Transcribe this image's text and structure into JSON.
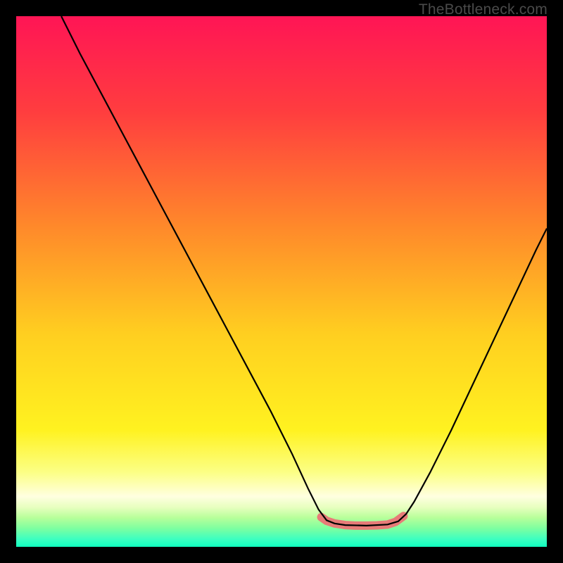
{
  "watermark": "TheBottleneck.com",
  "chart_data": {
    "type": "line",
    "title": "",
    "xlabel": "",
    "ylabel": "",
    "xlim": [
      0,
      100
    ],
    "ylim": [
      0,
      100
    ],
    "grid": false,
    "legend": false,
    "annotations": [],
    "gradient_stops": [
      {
        "offset": 0.0,
        "color": "#ff1555"
      },
      {
        "offset": 0.18,
        "color": "#ff3d3f"
      },
      {
        "offset": 0.4,
        "color": "#ff8a2a"
      },
      {
        "offset": 0.6,
        "color": "#ffcf20"
      },
      {
        "offset": 0.78,
        "color": "#fff220"
      },
      {
        "offset": 0.86,
        "color": "#fcff86"
      },
      {
        "offset": 0.905,
        "color": "#ffffe0"
      },
      {
        "offset": 0.925,
        "color": "#e8ffc0"
      },
      {
        "offset": 0.945,
        "color": "#b8ff9a"
      },
      {
        "offset": 0.965,
        "color": "#7effa0"
      },
      {
        "offset": 0.985,
        "color": "#3effc0"
      },
      {
        "offset": 1.0,
        "color": "#10ffbf"
      }
    ],
    "series": [
      {
        "name": "bottleneck-curve",
        "color": "#000000",
        "stroke_width": 2.2,
        "x": [
          8.5,
          12,
          16,
          20,
          24,
          28,
          32,
          36,
          40,
          44,
          48,
          52,
          55,
          57,
          58.5,
          60,
          62,
          66,
          70,
          72,
          73.5,
          75,
          78,
          82,
          86,
          90,
          94,
          98,
          100
        ],
        "y": [
          100,
          93,
          85.5,
          78,
          70.5,
          63,
          55.5,
          48,
          40.5,
          33,
          25.5,
          17.5,
          11,
          7,
          5,
          4.4,
          4.1,
          4.0,
          4.2,
          4.8,
          6.2,
          8.5,
          14,
          22,
          30.5,
          39,
          47.5,
          56,
          60
        ]
      },
      {
        "name": "trough-highlight",
        "color": "#e77b78",
        "stroke_width": 12,
        "linecap": "round",
        "x": [
          57.5,
          58.5,
          60,
          62,
          64,
          66,
          68,
          70,
          71.5,
          73
        ],
        "y": [
          5.6,
          4.9,
          4.4,
          4.1,
          4.0,
          4.0,
          4.05,
          4.2,
          4.7,
          5.8
        ]
      }
    ]
  }
}
